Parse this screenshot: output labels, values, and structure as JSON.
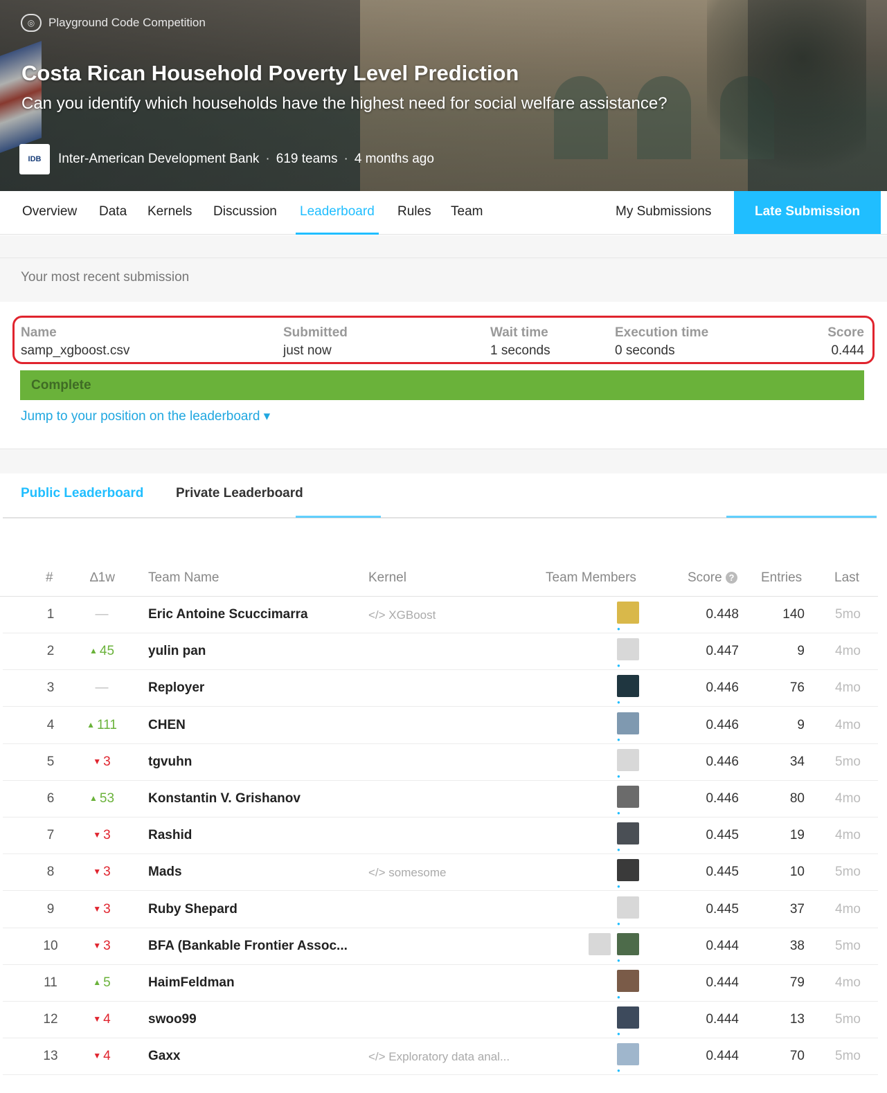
{
  "header": {
    "competition_type": "Playground Code Competition",
    "title": "Costa Rican Household Poverty Level Prediction",
    "subtitle": "Can you identify which households have the highest need for social welfare assistance?",
    "host_logo_text": "IDB",
    "host": "Inter-American Development Bank",
    "teams": "619 teams",
    "time": "4 months ago",
    "separator": "·"
  },
  "nav": {
    "tabs": [
      "Overview",
      "Data",
      "Kernels",
      "Discussion",
      "Leaderboard",
      "Rules",
      "Team"
    ],
    "active_tab": "Leaderboard",
    "my_submissions": "My Submissions",
    "late_submission": "Late Submission"
  },
  "submission": {
    "section_label": "Your most recent submission",
    "name_label": "Name",
    "name_value": "samp_xgboost.csv",
    "submitted_label": "Submitted",
    "submitted_value": "just now",
    "wait_label": "Wait time",
    "wait_value": "1 seconds",
    "exec_label": "Execution time",
    "exec_value": "0 seconds",
    "score_label": "Score",
    "score_value": "0.444",
    "status": "Complete",
    "jump_link": "Jump to your position on the leaderboard ▾"
  },
  "leaderboard": {
    "tabs": [
      "Public Leaderboard",
      "Private Leaderboard"
    ],
    "columns": [
      "#",
      "∆1w",
      "Team Name",
      "Kernel",
      "Team Members",
      "Score",
      "Entries",
      "Last"
    ],
    "colors": {
      "accent": "#20beff",
      "up": "#6ab23a",
      "down": "#e0242e"
    },
    "rows": [
      {
        "rank": "1",
        "delta": "—",
        "dir": "flat",
        "team": "Eric Antoine Scuccimarra",
        "kernel": "</> XGBoost",
        "score": "0.448",
        "entries": "140",
        "last": "5mo",
        "avatar_color": "#d9b84a",
        "avatar2": false
      },
      {
        "rank": "2",
        "delta": "45",
        "dir": "up",
        "team": "yulin pan",
        "kernel": "",
        "score": "0.447",
        "entries": "9",
        "last": "4mo",
        "avatar_color": "#d8d8d8",
        "avatar2": false
      },
      {
        "rank": "3",
        "delta": "—",
        "dir": "flat",
        "team": "Reployer",
        "kernel": "",
        "score": "0.446",
        "entries": "76",
        "last": "4mo",
        "avatar_color": "#1f3640",
        "avatar2": false
      },
      {
        "rank": "4",
        "delta": "111",
        "dir": "up",
        "team": "CHEN",
        "kernel": "",
        "score": "0.446",
        "entries": "9",
        "last": "4mo",
        "avatar_color": "#7f99b0",
        "avatar2": false
      },
      {
        "rank": "5",
        "delta": "3",
        "dir": "down",
        "team": "tgvuhn",
        "kernel": "",
        "score": "0.446",
        "entries": "34",
        "last": "5mo",
        "avatar_color": "#d8d8d8",
        "avatar2": false
      },
      {
        "rank": "6",
        "delta": "53",
        "dir": "up",
        "team": "Konstantin V. Grishanov",
        "kernel": "",
        "score": "0.446",
        "entries": "80",
        "last": "4mo",
        "avatar_color": "#6b6b6b",
        "avatar2": false
      },
      {
        "rank": "7",
        "delta": "3",
        "dir": "down",
        "team": "Rashid",
        "kernel": "",
        "score": "0.445",
        "entries": "19",
        "last": "4mo",
        "avatar_color": "#4a4f55",
        "avatar2": false
      },
      {
        "rank": "8",
        "delta": "3",
        "dir": "down",
        "team": "Mads",
        "kernel": "</> somesome",
        "score": "0.445",
        "entries": "10",
        "last": "5mo",
        "avatar_color": "#3a3a3a",
        "avatar2": false
      },
      {
        "rank": "9",
        "delta": "3",
        "dir": "down",
        "team": "Ruby Shepard",
        "kernel": "",
        "score": "0.445",
        "entries": "37",
        "last": "4mo",
        "avatar_color": "#d8d8d8",
        "avatar2": false
      },
      {
        "rank": "10",
        "delta": "3",
        "dir": "down",
        "team": "BFA (Bankable Frontier Assoc...",
        "kernel": "",
        "score": "0.444",
        "entries": "38",
        "last": "5mo",
        "avatar_color": "#4d6b4a",
        "avatar2": true
      },
      {
        "rank": "11",
        "delta": "5",
        "dir": "up",
        "team": "HaimFeldman",
        "kernel": "",
        "score": "0.444",
        "entries": "79",
        "last": "4mo",
        "avatar_color": "#7a5b48",
        "avatar2": false
      },
      {
        "rank": "12",
        "delta": "4",
        "dir": "down",
        "team": "swoo99",
        "kernel": "",
        "score": "0.444",
        "entries": "13",
        "last": "5mo",
        "avatar_color": "#3d4a5c",
        "avatar2": false
      },
      {
        "rank": "13",
        "delta": "4",
        "dir": "down",
        "team": "Gaxx",
        "kernel": "</> Exploratory data anal...",
        "score": "0.444",
        "entries": "70",
        "last": "5mo",
        "avatar_color": "#9fb6cc",
        "avatar2": false
      }
    ]
  }
}
